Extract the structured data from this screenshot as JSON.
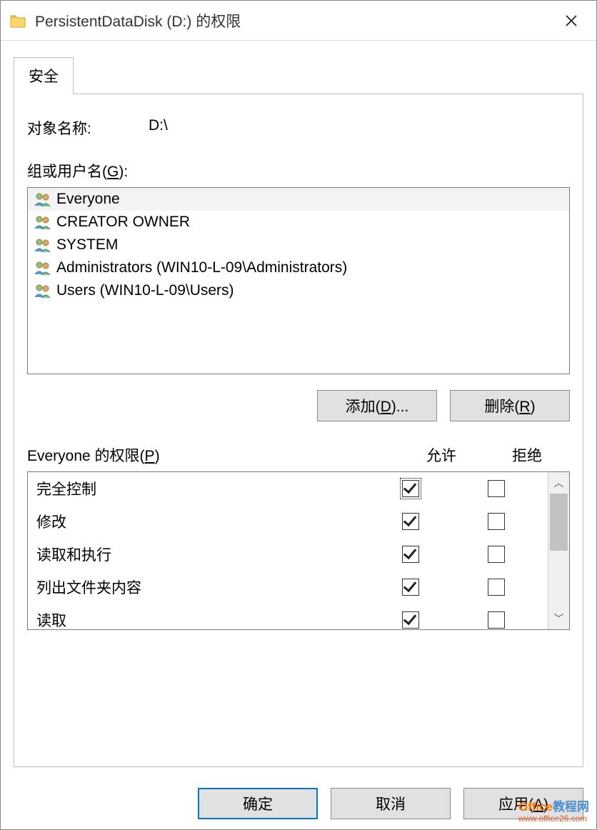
{
  "title": "PersistentDataDisk (D:) 的权限",
  "tab": "安全",
  "object_label": "对象名称:",
  "object_value": "D:\\",
  "group_label_pre": "组或用户名(",
  "group_label_u": "G",
  "group_label_post": "):",
  "users": [
    {
      "name": "Everyone",
      "selected": true
    },
    {
      "name": "CREATOR OWNER",
      "selected": false
    },
    {
      "name": "SYSTEM",
      "selected": false
    },
    {
      "name": "Administrators (WIN10-L-09\\Administrators)",
      "selected": false
    },
    {
      "name": "Users (WIN10-L-09\\Users)",
      "selected": false
    }
  ],
  "add_btn_pre": "添加(",
  "add_btn_u": "D",
  "add_btn_post": ")...",
  "remove_btn_pre": "删除(",
  "remove_btn_u": "R",
  "remove_btn_post": ")",
  "perm_header_left_pre": "Everyone 的权限(",
  "perm_header_left_u": "P",
  "perm_header_left_post": ")",
  "col_allow": "允许",
  "col_deny": "拒绝",
  "permissions": [
    {
      "label": "完全控制",
      "allow": true,
      "deny": false,
      "focused": true
    },
    {
      "label": "修改",
      "allow": true,
      "deny": false,
      "focused": false
    },
    {
      "label": "读取和执行",
      "allow": true,
      "deny": false,
      "focused": false
    },
    {
      "label": "列出文件夹内容",
      "allow": true,
      "deny": false,
      "focused": false
    },
    {
      "label": "读取",
      "allow": true,
      "deny": false,
      "focused": false
    }
  ],
  "ok_btn": "确定",
  "cancel_btn": "取消",
  "apply_btn_pre": "应用(",
  "apply_btn_u": "A",
  "apply_btn_post": ")",
  "watermark_line1a": "Office",
  "watermark_line1b": "教程网",
  "watermark_line2": "www.office26.com"
}
